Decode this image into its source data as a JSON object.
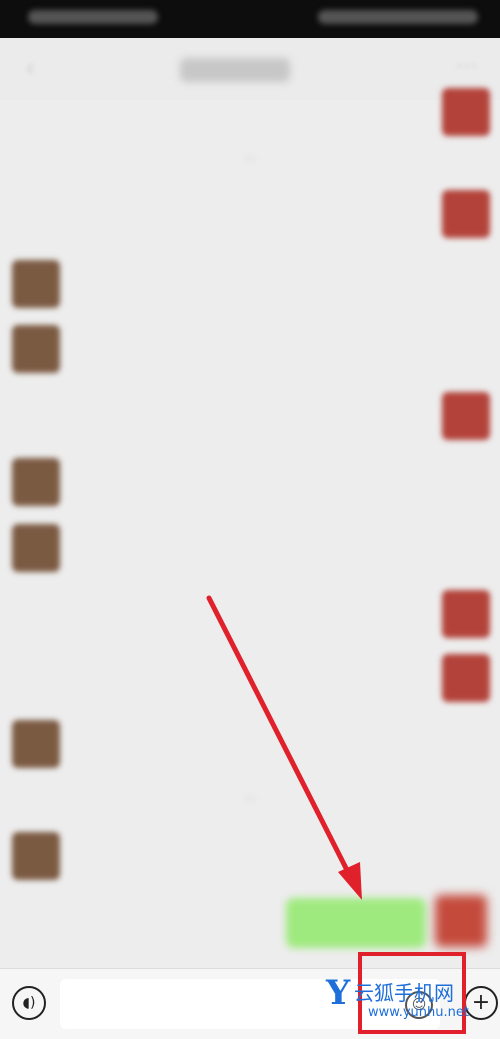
{
  "input": {
    "value": ""
  },
  "watermark": {
    "brand": "云狐手机网",
    "url": "www.yunhu.net"
  },
  "colors": {
    "sent_bubble": "#8ee86a",
    "received_bubble": "#ffffff",
    "annotation_red": "#e0202a",
    "watermark_blue": "#1e6fd9"
  },
  "icons": {
    "voice": "voice-icon",
    "emoji": "emoji-icon",
    "plus": "plus-icon"
  }
}
